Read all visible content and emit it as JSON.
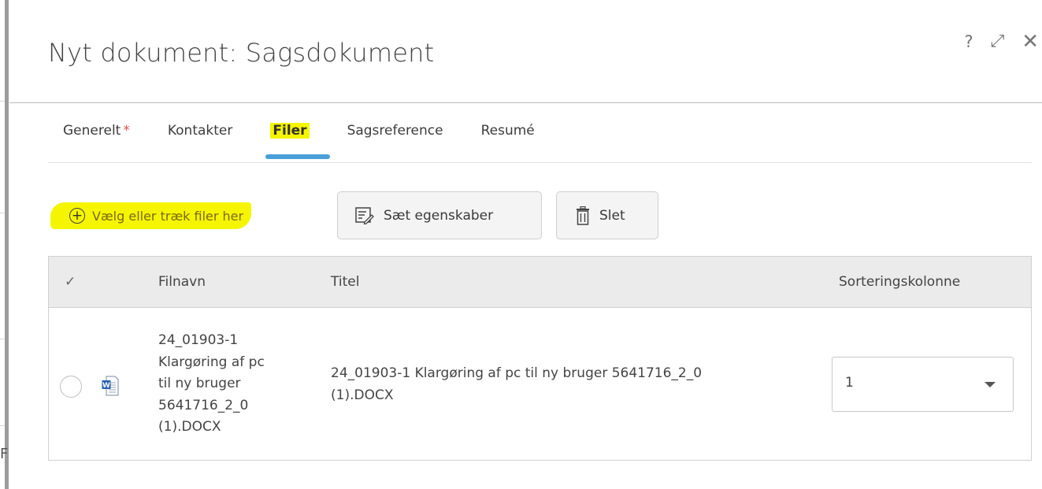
{
  "dialog": {
    "title": "Nyt dokument: Sagsdokument",
    "controls": {
      "help_icon": "?",
      "expand_icon": "⤢",
      "close_icon": "✕"
    }
  },
  "left_edge_letter": "F",
  "tabs": [
    {
      "label": "Generelt",
      "required_marker": "*",
      "active": false
    },
    {
      "label": "Kontakter",
      "active": false
    },
    {
      "label": "Filer",
      "active": true
    },
    {
      "label": "Sagsreference",
      "active": false
    },
    {
      "label": "Resumé",
      "active": false
    }
  ],
  "toolbar": {
    "add_files_label": "Vælg eller træk filer her",
    "add_files_icon": "plus-circle-icon",
    "set_properties_label": "Sæt egenskaber",
    "set_properties_icon": "edit-list-icon",
    "delete_label": "Slet",
    "delete_icon": "trash-icon"
  },
  "table": {
    "headers": {
      "check": "✓",
      "filename": "Filnavn",
      "title": "Titel",
      "sort": "Sorteringskolonne"
    },
    "rows": [
      {
        "filename_lines": [
          "24_01903-1",
          "Klargøring af pc",
          "til ny bruger",
          "5641716_2_0",
          "(1).DOCX"
        ],
        "title_lines": [
          "24_01903-1 Klargøring af pc til ny bruger 5641716_2_0",
          "(1).DOCX"
        ],
        "sort_value": "1",
        "file_icon": "word-document-icon"
      }
    ]
  },
  "colors": {
    "highlight": "#f5f500",
    "tab_underline": "#4a9fd8",
    "required": "#d9534f",
    "header_bg": "#ebebeb"
  }
}
